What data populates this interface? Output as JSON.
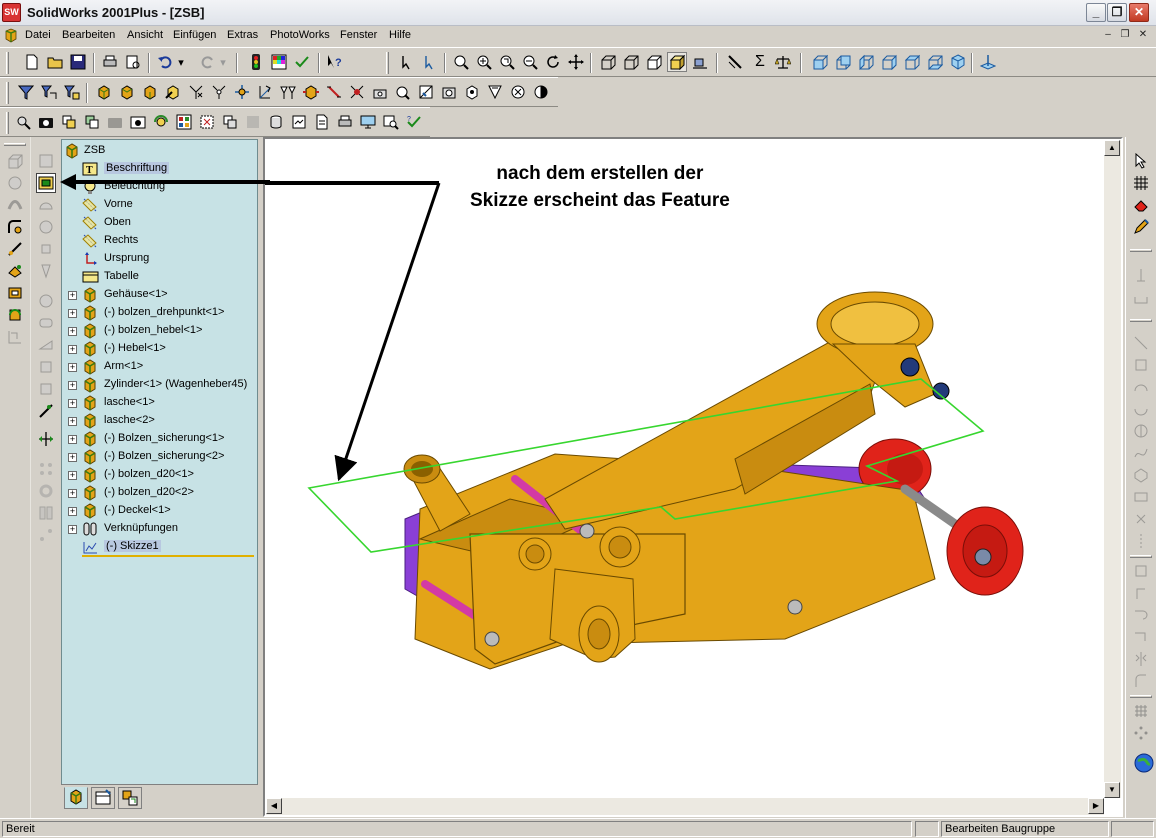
{
  "window": {
    "app_icon": "SW",
    "title": "SolidWorks 2001Plus - [ZSB]",
    "controls": [
      "minimize-icon",
      "restore-icon",
      "close-icon"
    ]
  },
  "menubar": {
    "items": [
      "Datei",
      "Bearbeiten",
      "Ansicht",
      "Einfügen",
      "Extras",
      "PhotoWorks",
      "Fenster",
      "Hilfe"
    ]
  },
  "tree": {
    "items": [
      {
        "label": "ZSB",
        "icon": "assembly-icon",
        "expander": ""
      },
      {
        "label": "Beschriftung",
        "icon": "annotation-icon",
        "expander": "",
        "selected": true
      },
      {
        "label": "Beleuchtung",
        "icon": "lighting-icon",
        "expander": ""
      },
      {
        "label": "Vorne",
        "icon": "plane-icon",
        "expander": ""
      },
      {
        "label": "Oben",
        "icon": "plane-icon",
        "expander": ""
      },
      {
        "label": "Rechts",
        "icon": "plane-icon",
        "expander": ""
      },
      {
        "label": "Ursprung",
        "icon": "origin-icon",
        "expander": ""
      },
      {
        "label": "Tabelle",
        "icon": "table-icon",
        "expander": ""
      },
      {
        "label": "Gehäuse<1>",
        "icon": "part-icon",
        "expander": "+"
      },
      {
        "label": "(-) bolzen_drehpunkt<1>",
        "icon": "part-icon",
        "expander": "+"
      },
      {
        "label": "(-) bolzen_hebel<1>",
        "icon": "part-icon",
        "expander": "+"
      },
      {
        "label": "(-) Hebel<1>",
        "icon": "part-icon",
        "expander": "+"
      },
      {
        "label": "Arm<1>",
        "icon": "part-icon",
        "expander": "+"
      },
      {
        "label": "Zylinder<1> (Wagenheber45)",
        "icon": "part-icon",
        "expander": "+"
      },
      {
        "label": "lasche<1>",
        "icon": "part-icon",
        "expander": "+"
      },
      {
        "label": "lasche<2>",
        "icon": "part-icon",
        "expander": "+"
      },
      {
        "label": "(-) Bolzen_sicherung<1>",
        "icon": "part-icon",
        "expander": "+"
      },
      {
        "label": "(-) Bolzen_sicherung<2>",
        "icon": "part-icon",
        "expander": "+"
      },
      {
        "label": "(-) bolzen_d20<1>",
        "icon": "part-icon",
        "expander": "+"
      },
      {
        "label": "(-) bolzen_d20<2>",
        "icon": "part-icon",
        "expander": "+"
      },
      {
        "label": "(-) Deckel<1>",
        "icon": "part-icon",
        "expander": "+"
      },
      {
        "label": "Verknüpfungen",
        "icon": "mates-icon",
        "expander": "+"
      },
      {
        "label": "(-) Skizze1",
        "icon": "sketch-icon",
        "expander": "",
        "selected": true
      }
    ]
  },
  "annotation": {
    "line1": "nach dem erstellen der",
    "line2": "Skizze erscheint das Feature"
  },
  "statusbar": {
    "left": "Bereit",
    "right": "Bearbeiten Baugruppe"
  },
  "colors": {
    "tree_bg": "#c7e2e5",
    "part_yellow": "#e3a418",
    "part_purple": "#8a3fd6",
    "wheel_red": "#e0231a",
    "sketch_green": "#37d62f"
  }
}
